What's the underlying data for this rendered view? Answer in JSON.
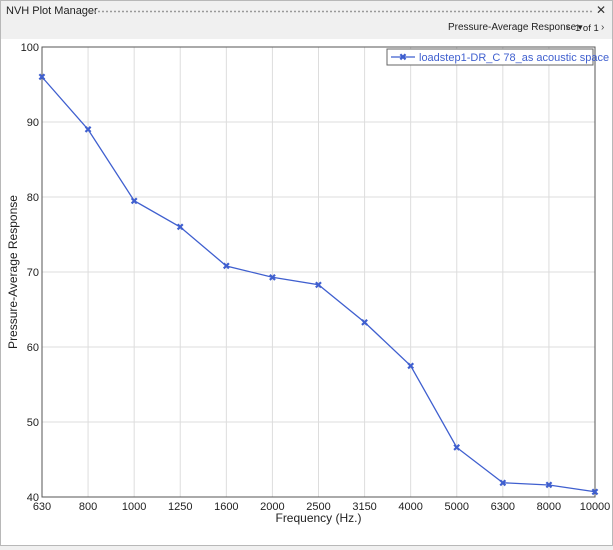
{
  "window": {
    "title": "NVH Plot Manager"
  },
  "toolbar": {
    "plot_selector": "Pressure-Average Response",
    "page_indicator": "1 of 1"
  },
  "icons": {
    "close": "close-icon",
    "dropdown": "triangle-down-icon",
    "prev": "chevron-left-icon",
    "next": "chevron-right-icon"
  },
  "chart_data": {
    "type": "line",
    "xlabel": "Frequency (Hz.)",
    "ylabel": "Pressure-Average Response",
    "categories": [
      "630",
      "800",
      "1000",
      "1250",
      "1600",
      "2000",
      "2500",
      "3150",
      "4000",
      "5000",
      "6300",
      "8000",
      "10000"
    ],
    "ylim": [
      40,
      100
    ],
    "yticks": [
      40,
      50,
      60,
      70,
      80,
      90,
      100
    ],
    "grid": true,
    "legend_position": "top-right",
    "series_color": "#3f5fcf",
    "series": [
      {
        "name": "loadstep1-DR_C 78_as acoustic space",
        "values": [
          96,
          89,
          79.5,
          76,
          70.8,
          69.3,
          68.3,
          63.3,
          57.5,
          46.6,
          41.9,
          41.6,
          40.7
        ]
      }
    ]
  }
}
